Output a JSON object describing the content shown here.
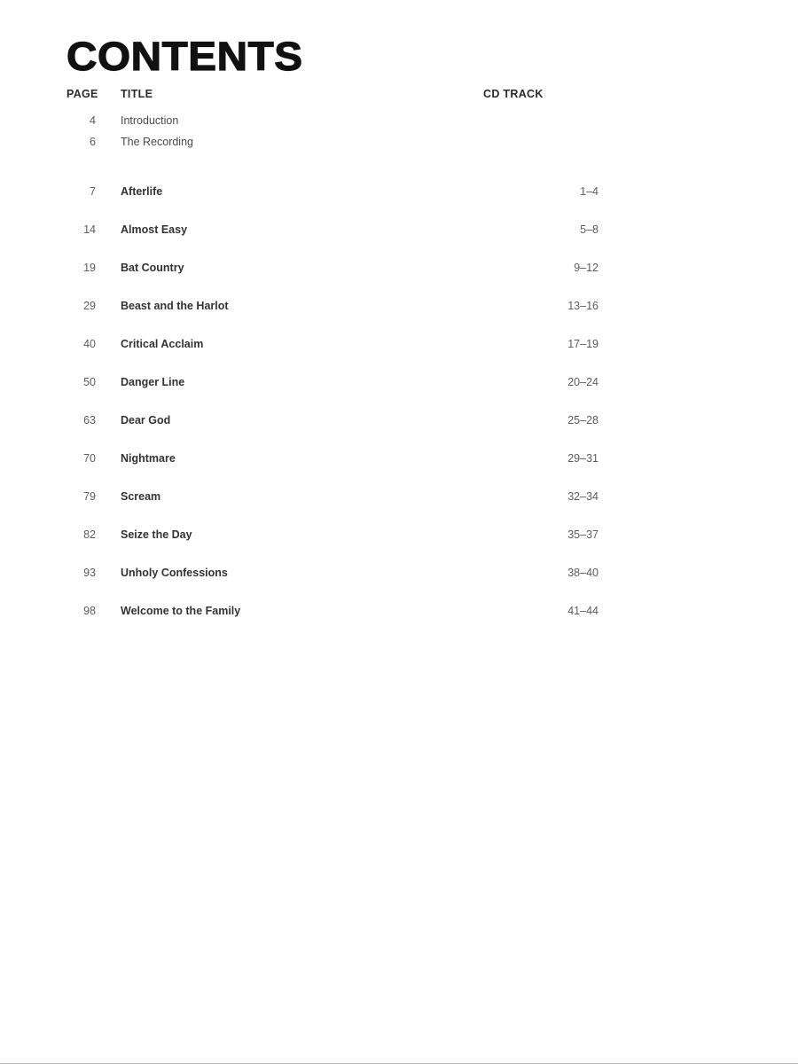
{
  "document": {
    "title": "CONTENTS",
    "columns": {
      "page": "PAGE",
      "title": "TITLE",
      "track": "CD TRACK"
    }
  },
  "front_matter": [
    {
      "page": "4",
      "title": "Introduction",
      "track": ""
    },
    {
      "page": "6",
      "title": "The Recording",
      "track": ""
    }
  ],
  "songs": [
    {
      "page": "7",
      "title": "Afterlife",
      "track": "1–4"
    },
    {
      "page": "14",
      "title": "Almost Easy",
      "track": "5–8"
    },
    {
      "page": "19",
      "title": "Bat Country",
      "track": "9–12"
    },
    {
      "page": "29",
      "title": "Beast and the Harlot",
      "track": "13–16"
    },
    {
      "page": "40",
      "title": "Critical Acclaim",
      "track": "17–19"
    },
    {
      "page": "50",
      "title": "Danger Line",
      "track": "20–24"
    },
    {
      "page": "63",
      "title": "Dear God",
      "track": "25–28"
    },
    {
      "page": "70",
      "title": "Nightmare",
      "track": "29–31"
    },
    {
      "page": "79",
      "title": "Scream",
      "track": "32–34"
    },
    {
      "page": "82",
      "title": "Seize the Day",
      "track": "35–37"
    },
    {
      "page": "93",
      "title": "Unholy Confessions",
      "track": "38–40"
    },
    {
      "page": "98",
      "title": "Welcome to the Family",
      "track": "41–44"
    }
  ]
}
